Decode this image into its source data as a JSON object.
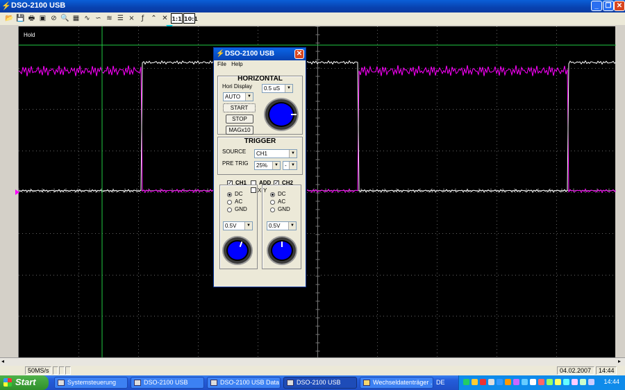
{
  "window": {
    "title": "DSO-2100 USB"
  },
  "toolbar": {
    "zoom_1to1": "1:1",
    "zoom_10to1": "10:1"
  },
  "scope": {
    "hold_label": "Hold",
    "ch1_color": "#ff00ff",
    "ch2_color": "#ffffff"
  },
  "dialog": {
    "title": "DSO-2100 USB",
    "menu": [
      "File",
      "Help"
    ],
    "horizontal": {
      "title": "HORIZONTAL",
      "hori_display_label": "Hori Display",
      "hori_display_value": "AUTO",
      "timebase_value": "0.5 uS",
      "start_label": "START",
      "stop_label": "STOP",
      "magx10_label": "MAGx10"
    },
    "trigger": {
      "title": "TRIGGER",
      "source_label": "SOURCE",
      "source_value": "CH1",
      "pre_trig_label": "PRE TRIG",
      "pre_trig_value": "25%",
      "pre_trig_extra": "-"
    },
    "channels": {
      "ch1_label": "CH1",
      "add_label": "ADD",
      "ch2_label": "CH2",
      "xy_label": "X-Y",
      "ch1": {
        "coupling": [
          "DC",
          "AC",
          "GND"
        ],
        "selected": "DC",
        "volts_div": "0.5V"
      },
      "ch2": {
        "coupling": [
          "DC",
          "AC",
          "GND"
        ],
        "selected": "DC",
        "volts_div": "0.5V"
      }
    }
  },
  "status": {
    "sample_rate": "50MS/s",
    "date": "04.02.2007",
    "time": "14:44"
  },
  "taskbar": {
    "start_label": "Start",
    "tasks": [
      "Systemsteuerung",
      "DSO-2100 USB",
      "DSO-2100 USB Data",
      "DSO-2100 USB",
      "Wechseldatenträger ..."
    ],
    "language": "DE",
    "clock": "14:44"
  }
}
